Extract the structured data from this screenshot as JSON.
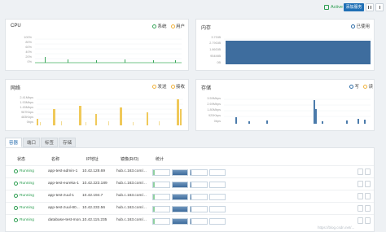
{
  "header": {
    "status_text": "Active",
    "add_button_label": "添加服务"
  },
  "panels": {
    "cpu": {
      "title": "CPU",
      "legend": [
        "系统",
        "用户"
      ],
      "legend_colors": [
        "#3aa65b",
        "#f0b33e"
      ],
      "y_ticks": [
        "100%",
        "80%",
        "60%",
        "40%",
        "20%",
        "0%"
      ]
    },
    "memory": {
      "title": "内存",
      "legend": [
        "已使用"
      ],
      "legend_colors": [
        "#2f6ea8"
      ],
      "y_ticks": [
        "3.7GiB",
        "2.79GiB",
        "1.86GiB",
        "954MiB",
        "0B"
      ]
    },
    "network": {
      "title": "网络",
      "legend": [
        "发送",
        "接收"
      ],
      "legend_colors": [
        "#f0b33e",
        "#d8c46a"
      ],
      "y_ticks": [
        "2.41Mbps",
        "1.93Mbps",
        "1.45Mbps",
        "967Kbps",
        "483Kbps",
        "0bps"
      ]
    },
    "storage": {
      "title": "存储",
      "legend": [
        "写",
        "读"
      ],
      "legend_colors": [
        "#2f6ea8",
        "#f0b33e"
      ],
      "y_ticks": [
        "3.59Mbps",
        "2.69Mbps",
        "1.80Mbps",
        "920Kbps",
        "0bps"
      ]
    }
  },
  "tabs": [
    "容器",
    "端口",
    "标签",
    "存储"
  ],
  "table": {
    "columns": [
      "状态",
      "名称",
      "IP地址",
      "镜像(R/O)",
      "统计"
    ],
    "rows": [
      {
        "status": "Running",
        "name": "app-test-admin-1",
        "ip": "10.42.128.69",
        "image": "hub.c.163.com/..."
      },
      {
        "status": "Running",
        "name": "app-test-eureka-1",
        "ip": "10.42.223.189",
        "image": "hub.c.163.com/..."
      },
      {
        "status": "Running",
        "name": "app-test-zuul-1",
        "ip": "10.42.194.7",
        "image": "hub.c.163.com/..."
      },
      {
        "status": "Running",
        "name": "app-test-zuul-80...",
        "ip": "10.42.232.56",
        "image": "hub.c.163.com/..."
      },
      {
        "status": "Running",
        "name": "database-test-mon...",
        "ip": "10.42.115.235",
        "image": "hub.c.163.com/..."
      }
    ]
  },
  "watermark": "https://blog.csdn.net/..."
}
